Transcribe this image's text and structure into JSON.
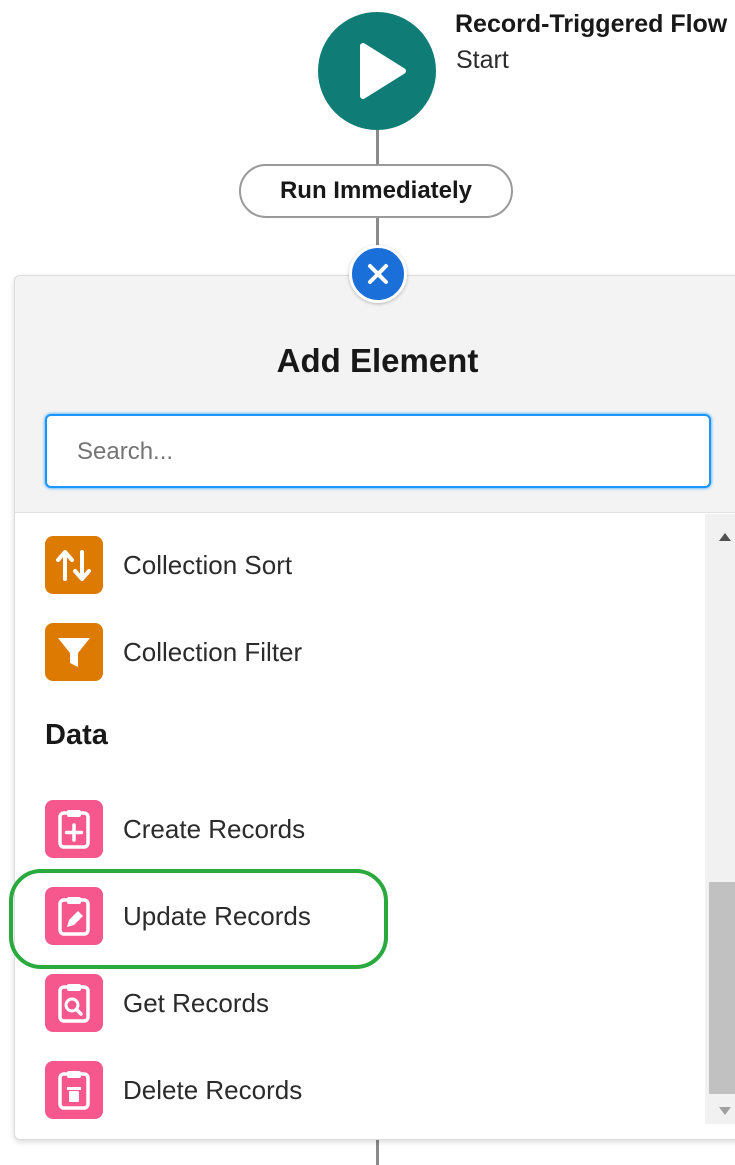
{
  "flow": {
    "title": "Record-Triggered Flow",
    "subtitle": "Start",
    "run_label": "Run Immediately"
  },
  "panel": {
    "title": "Add Element",
    "search_placeholder": "Search..."
  },
  "items": [
    {
      "label": "Collection Sort",
      "icon": "collection-sort-icon",
      "color": "#dd7a01"
    },
    {
      "label": "Collection Filter",
      "icon": "collection-filter-icon",
      "color": "#dd7a01"
    }
  ],
  "section_data": {
    "heading": "Data",
    "items": [
      {
        "label": "Create Records",
        "icon": "create-records-icon",
        "color": "#f6588d"
      },
      {
        "label": "Update Records",
        "icon": "update-records-icon",
        "color": "#f6588d"
      },
      {
        "label": "Get Records",
        "icon": "get-records-icon",
        "color": "#f6588d"
      },
      {
        "label": "Delete Records",
        "icon": "delete-records-icon",
        "color": "#f6588d"
      }
    ]
  },
  "colors": {
    "start_node": "#0f7d75",
    "close_button": "#1b6fd9",
    "highlight": "#2aaa3e"
  }
}
